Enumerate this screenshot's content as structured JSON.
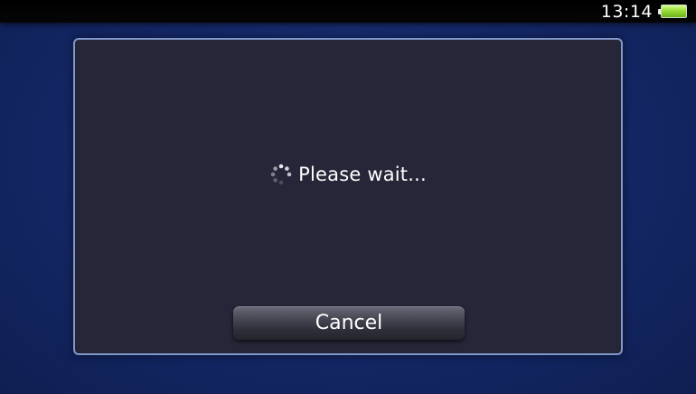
{
  "status_bar": {
    "time": "13:14",
    "battery_icon": "battery-icon"
  },
  "dialog": {
    "loading_icon": "loading-spinner-icon",
    "message": "Please wait...",
    "cancel_label": "Cancel"
  },
  "colors": {
    "background": "#15296a",
    "dialog_bg": "#272638",
    "dialog_border": "#7f97c9",
    "battery": "#9ee03a"
  }
}
